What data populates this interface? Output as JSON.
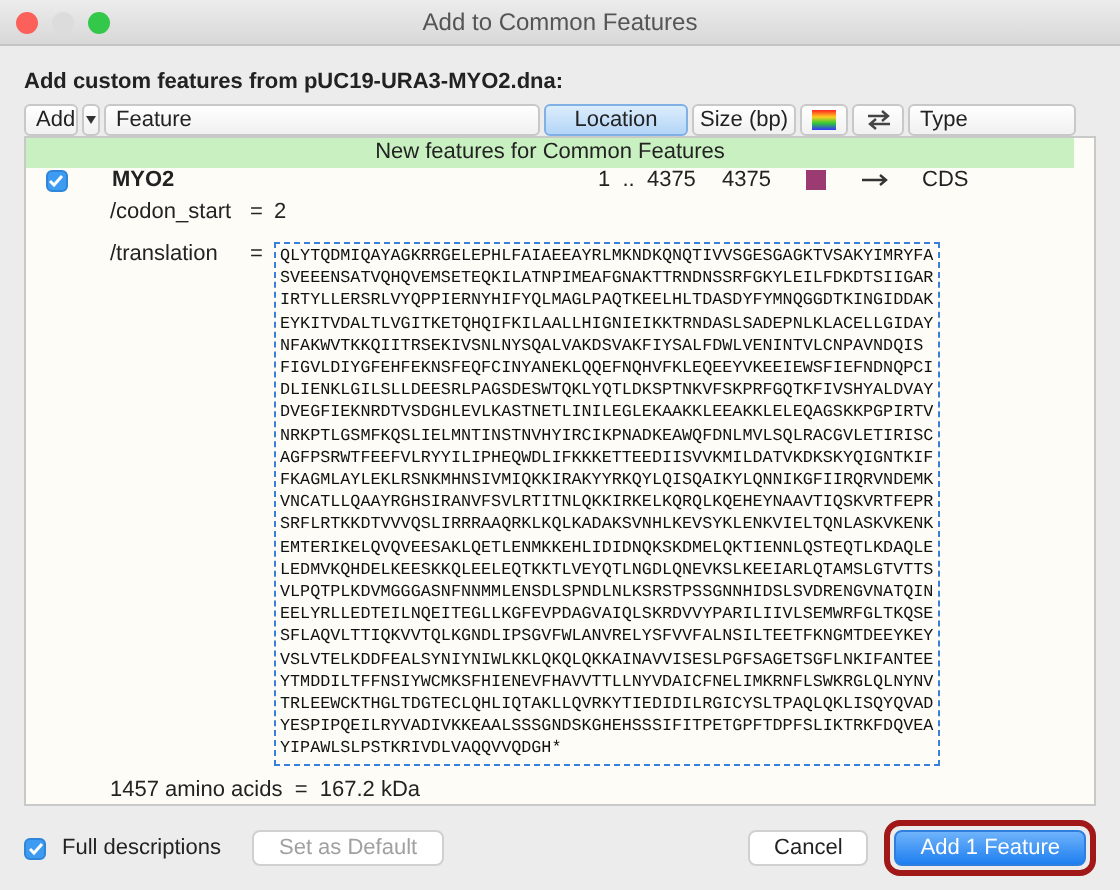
{
  "window": {
    "title": "Add to Common Features"
  },
  "heading": "Add custom features from pUC19-URA3-MYO2.dna:",
  "header": {
    "add_button": "Add",
    "columns": [
      {
        "kind": "text",
        "label": "Feature",
        "selected": false
      },
      {
        "kind": "text",
        "label": "Location",
        "selected": true
      },
      {
        "kind": "text",
        "label": "Size (bp)",
        "selected": false
      },
      {
        "kind": "color",
        "selected": false
      },
      {
        "kind": "direction",
        "selected": false
      },
      {
        "kind": "text",
        "label": "Type",
        "selected": false
      }
    ]
  },
  "group_banner": "New features for Common Features",
  "feature": {
    "checked": true,
    "name": "MYO2",
    "location": "1  ..  4375",
    "size": "4375",
    "color": "#9b3b72",
    "type": "CDS",
    "qualifiers": [
      {
        "kind": "value",
        "name": "/codon_start",
        "separator": "=",
        "value": "2"
      },
      {
        "kind": "sequence",
        "name": "/translation",
        "separator": "=",
        "lines": [
          "QLYTQDMIQAYAGKRRGELEPHLFAIAEEAYRLMKNDKQNQTIVVSGESGAGKTVSAKYIMRYFA",
          "SVEEENSATVQHQVEMSETEQKILATNPIMEAFGNAKTTRNDNSSRFGKYLEILFDKDTSIIGAR",
          "IRTYLLERSRLVYQPPIERNYHIFYQLMAGLPAQTKEELHLTDASDYFYMNQGGDTKINGIDDAK",
          "EYKITVDALTLVGITKETQHQIFKILAALLHIGNIEIKKTRNDASLSADEPNLKLACELLGIDAY",
          "NFAKWVTKKQIITRSEKIVSNLNYSQALVAKDSVAKFIYSALFDWLVENINTVLCNPAVNDQIS",
          "FIGVLDIYGFEHFEKNSFEQFCINYANEKLQQEFNQHVFKLEQEEYVKEEIEWSFIEFNDNQPCI",
          "DLIENKLGILSLLDEESRLPAGSDESWTQKLYQTLDKSPTNKVFSKPRFGQTKFIVSHYALDVAY",
          "DVEGFIEKNRDTVSDGHLEVLKASTNETLINILEGLEKAAKKLEEAKKLELEQAGSKKPGPIRTV",
          "NRKPTLGSMFKQSLIELMNTINSTNVHYIRCIKPNADKEAWQFDNLMVLSQLRACGVLETIRISC",
          "AGFPSRWTFEEFVLRYYILIPHEQWDLIFKKKETTEEDIISVVKMILDATVKDKSKYQIGNTKIF",
          "FKAGMLAYLEKLRSNKMHNSIVMIQKKIRAKYYRKQYLQISQAIKYLQNNIKGFIIRQRVNDEMK",
          "VNCATLLQAAYRGHSIRANVFSVLRTITNLQKKIRKELKQRQLKQEHEYNAAVTIQSKVRTFEPR",
          "SRFLRTKKDTVVVQSLIRRRAAQRKLKQLKADAKSVNHLKEVSYKLENKVIELTQNLASKVKENK",
          "EMTERIKELQVQVEESAKLQETLENMKKEHLIDIDNQKSKDMELQKTIENNLQSTEQTLKDAQLE",
          "LEDMVKQHDELKEESKKQLEELEQTKKTLVEYQTLNGDLQNEVKSLKEEIARLQTAMSLGTVTTS",
          "VLPQTPLKDVMGGGASNFNNMMLENSDLSPNDLNLKSRSTPSSGNNHIDSLSVDRENGVNATQIN",
          "EELYRLLEDTEILNQEITEGLLKGFEVPDAGVAIQLSKRDVVYPARILIIVLSEMWRFGLTKQSE",
          "SFLAQVLTTIQKVVTQLKGNDLIPSGVFWLANVRELYSFVVFALNSILTEETFKNGMTDEEYKEY",
          "VSLVTELKDDFEALSYNIYNIWLKKLQKQLQKKAINAVVISESLPGFSAGETSGFLNKIFANTEE",
          "YTMDDILTFFNSIYWCMKSFHIENEVFHAVVTTLLNYVDAICFNELIMKRNFLSWKRGLQLNYNV",
          "TRLEEWCKTHGLTDGTECLQHLIQTAKLLQVRKYTIEDIDILRGICYSLTPAQLQKLISQYQVAD",
          "YESPIPQEILRYVADIVKKEAALSSSGNDSKGHEHSSSIFITPETGPFTDPFSLIKTRKFDQVEA",
          "YIPAWLSLPSTKRIVDLVAQQVVQDGH*"
        ]
      }
    ],
    "summary": "1457 amino acids  =  167.2 kDa"
  },
  "footer": {
    "full_descriptions": {
      "label": "Full descriptions",
      "checked": true
    },
    "buttons": [
      {
        "kind": "secondary",
        "label": "Set as Default",
        "disabled": true,
        "highlighted": false
      },
      {
        "kind": "secondary",
        "label": "Cancel",
        "disabled": false,
        "highlighted": false
      },
      {
        "kind": "primary",
        "label": "Add 1 Feature",
        "disabled": false,
        "highlighted": true
      }
    ]
  }
}
